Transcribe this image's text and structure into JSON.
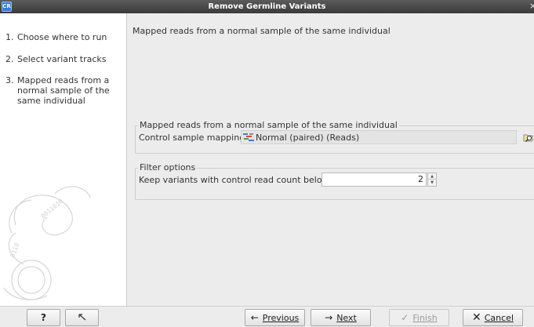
{
  "window": {
    "app_icon_text": "CR",
    "title": "Remove Germline Variants",
    "close_glyph": "×"
  },
  "sidebar": {
    "steps": [
      {
        "number": "1.",
        "label": "Choose where to run"
      },
      {
        "number": "2.",
        "label": "Select variant tracks"
      },
      {
        "number": "3.",
        "label": "Mapped reads from a normal sample of the same individual"
      }
    ]
  },
  "main": {
    "heading": "Mapped reads from a normal sample of the same individual",
    "mapped_group": {
      "title": "Mapped reads from a normal sample of the same individual",
      "field_label": "Control sample mapping",
      "field_value": "Normal (paired) (Reads)",
      "field_icon": "reads-track-icon",
      "browse_icon": "browse-folder-icon"
    },
    "filter_group": {
      "title": "Filter options",
      "field_label": "Keep variants with control read count below",
      "field_value": "2"
    }
  },
  "footer": {
    "help_label": "?",
    "reset_icon": "reset-arrow-icon",
    "previous_label": "Previous",
    "next_label": "Next",
    "finish_label": "Finish",
    "cancel_label": "Cancel"
  },
  "colors": {
    "titlebar": "#3a3a3a",
    "sidebar_bg": "#ffffff",
    "panel_bg": "#ececec"
  }
}
